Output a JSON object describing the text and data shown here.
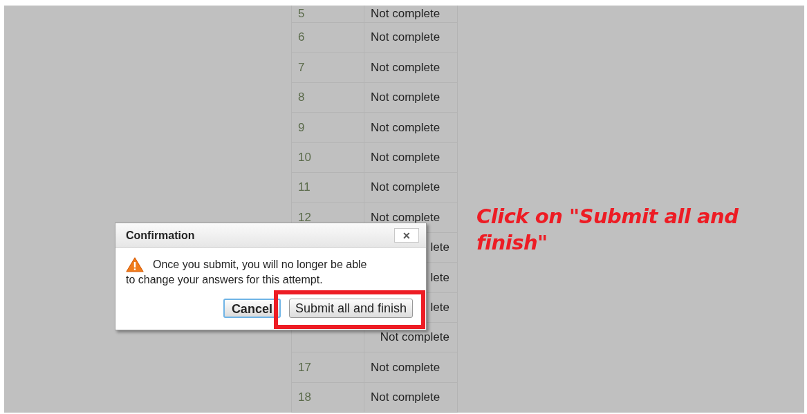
{
  "table": {
    "rows": [
      {
        "number": "5",
        "status": "Not complete"
      },
      {
        "number": "6",
        "status": "Not complete"
      },
      {
        "number": "7",
        "status": "Not complete"
      },
      {
        "number": "8",
        "status": "Not complete"
      },
      {
        "number": "9",
        "status": "Not complete"
      },
      {
        "number": "10",
        "status": "Not complete"
      },
      {
        "number": "11",
        "status": "Not complete"
      },
      {
        "number": "12",
        "status": "Not complete"
      },
      {
        "status": "lete"
      },
      {
        "status": "lete"
      },
      {
        "status": "lete"
      },
      {
        "status": "Not complete"
      },
      {
        "number": "17",
        "status": "Not complete"
      },
      {
        "number": "18",
        "status": "Not complete"
      }
    ]
  },
  "dialog": {
    "title": "Confirmation",
    "close": "✕",
    "message_lines": [
      "Once you submit, you will no longer be able",
      "to change your answers for this attempt."
    ],
    "buttons": [
      {
        "label": "Cancel",
        "focused": true
      },
      {
        "label": "Submit all and finish",
        "focused": false
      }
    ]
  },
  "annotation": {
    "text": "Click on \"Submit all and finish\""
  }
}
